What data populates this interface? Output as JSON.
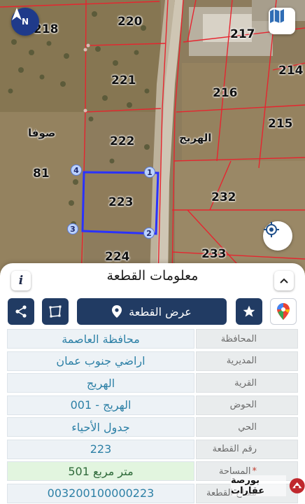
{
  "map": {
    "compass_label": "N",
    "village_label": "الهريج",
    "area_label": "صوفا",
    "parcel_labels": [
      "218",
      "220",
      "217",
      "214",
      "221",
      "216",
      "215",
      "222",
      "81",
      "223",
      "232",
      "224",
      "233"
    ],
    "corner_labels": [
      "1",
      "2",
      "3",
      "4"
    ],
    "colors": {
      "boundary": "#e6252f",
      "selected_parcel": "#2a32ff",
      "road": "#cfc6b4"
    }
  },
  "panel": {
    "title": "معلومات القطعة",
    "info_icon_label": "i",
    "show_parcel_label": "عرض القطعة",
    "rows": [
      {
        "key": "المحافظة",
        "value": "محافظة العاصمة"
      },
      {
        "key": "المديرية",
        "value": "اراضي جنوب عمان"
      },
      {
        "key": "القرية",
        "value": "الهريج"
      },
      {
        "key": "الحوض",
        "value": "الهريج - 001"
      },
      {
        "key": "الحي",
        "value": "جدول الأحياء"
      },
      {
        "key": "رقم القطعة",
        "value": "223"
      },
      {
        "key": "المساحة",
        "required_mark": "*",
        "value": "501   متر مربع"
      },
      {
        "key": "مفتاح القطعة",
        "value": "003200100000223"
      }
    ]
  },
  "watermark": {
    "text": "بورصة عقارات"
  },
  "icons": [
    "compass-icon",
    "map-type-icon",
    "locate-icon",
    "info-icon",
    "chevron-up-icon",
    "share-icon",
    "polygon-icon",
    "location-pin-icon",
    "star-icon",
    "google-maps-icon"
  ]
}
